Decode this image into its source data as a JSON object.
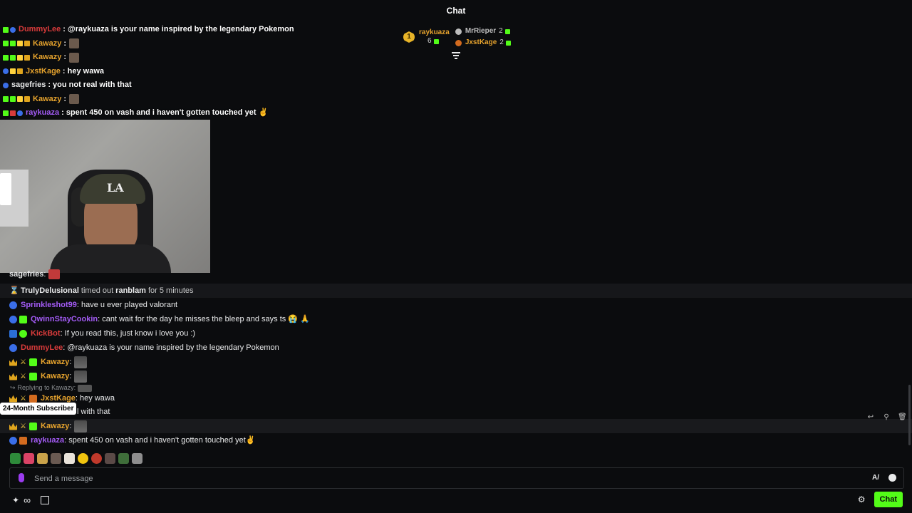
{
  "header": {
    "title": "Chat"
  },
  "overlay_messages": [
    {
      "user": "DummyLee",
      "color": "#d93b3b",
      "text": ": @raykuaza is your name inspired by the legendary Pokemon",
      "emote": false
    },
    {
      "user": "Kawazy",
      "color": "#e5a22d",
      "text": ":",
      "emote": true
    },
    {
      "user": "Kawazy",
      "color": "#e5a22d",
      "text": ":",
      "emote": true
    },
    {
      "user": "JxstKage",
      "color": "#e5a22d",
      "text": ": hey wawa",
      "emote": false
    },
    {
      "user": "sagefries",
      "color": "#e9eaeb",
      "text": ": you not real with that",
      "emote": false
    },
    {
      "user": "Kawazy",
      "color": "#e5a22d",
      "text": ":",
      "emote": true
    },
    {
      "user": "raykuaza",
      "color": "#a35bf5",
      "text": ": spent 450 on vash and i haven't gotten touched yet ✌",
      "emote": false
    }
  ],
  "leaderboard": {
    "first": {
      "rank": "1",
      "name": "raykuaza",
      "count": "6"
    },
    "others": [
      {
        "name": "MrRieper",
        "count": "2",
        "color": "#bcbcbc"
      },
      {
        "name": "JxstKage",
        "count": "2",
        "color": "#e5a22d"
      }
    ]
  },
  "webcam": {
    "cap_logo": "LA"
  },
  "chat": {
    "top_partial": {
      "user": "sagefries",
      "text": ":"
    },
    "system": {
      "actor": "TrulyDelusional",
      "action": "timed out",
      "target": "ranblam",
      "suffix": "for 5 minutes"
    },
    "messages": [
      {
        "user": "Sprinkleshot99",
        "color": "#a35bf5",
        "text": ": have u ever played valorant"
      },
      {
        "user": "QwinnStayCookin",
        "color": "#a35bf5",
        "text": ": cant wait for the day he misses the bleep and says ts 😭 🙏"
      },
      {
        "user": "KickBot",
        "color": "#d93b3b",
        "text": ": If you read this, just know i love you :)"
      },
      {
        "user": "DummyLee",
        "color": "#d93b3b",
        "text": ": @raykuaza is your name inspired by the legendary Pokemon"
      },
      {
        "user": "Kawazy",
        "color": "#e5a22d",
        "text": ":"
      },
      {
        "user": "Kawazy",
        "color": "#e5a22d",
        "text": ":"
      }
    ],
    "reply_label": "Replying to Kawazy:",
    "reply_msg": {
      "user": "JxstKage",
      "color": "#e5a22d",
      "text": ": hey wawa"
    },
    "partial_msg": {
      "text": "l with that"
    },
    "hover_msg": {
      "user": "Kawazy",
      "color": "#e5a22d",
      "text": ":"
    },
    "last_msg": {
      "user": "raykuaza",
      "color": "#a35bf5",
      "text": ": spent 450 on vash and i haven't gotten touched yet✌"
    }
  },
  "tooltip": {
    "text": "24-Month Subscriber"
  },
  "input": {
    "placeholder": "Send a message"
  },
  "footer": {
    "chat_button": "Chat"
  },
  "colors": {
    "accent": "#53fc18",
    "background": "#0b0c0e"
  }
}
